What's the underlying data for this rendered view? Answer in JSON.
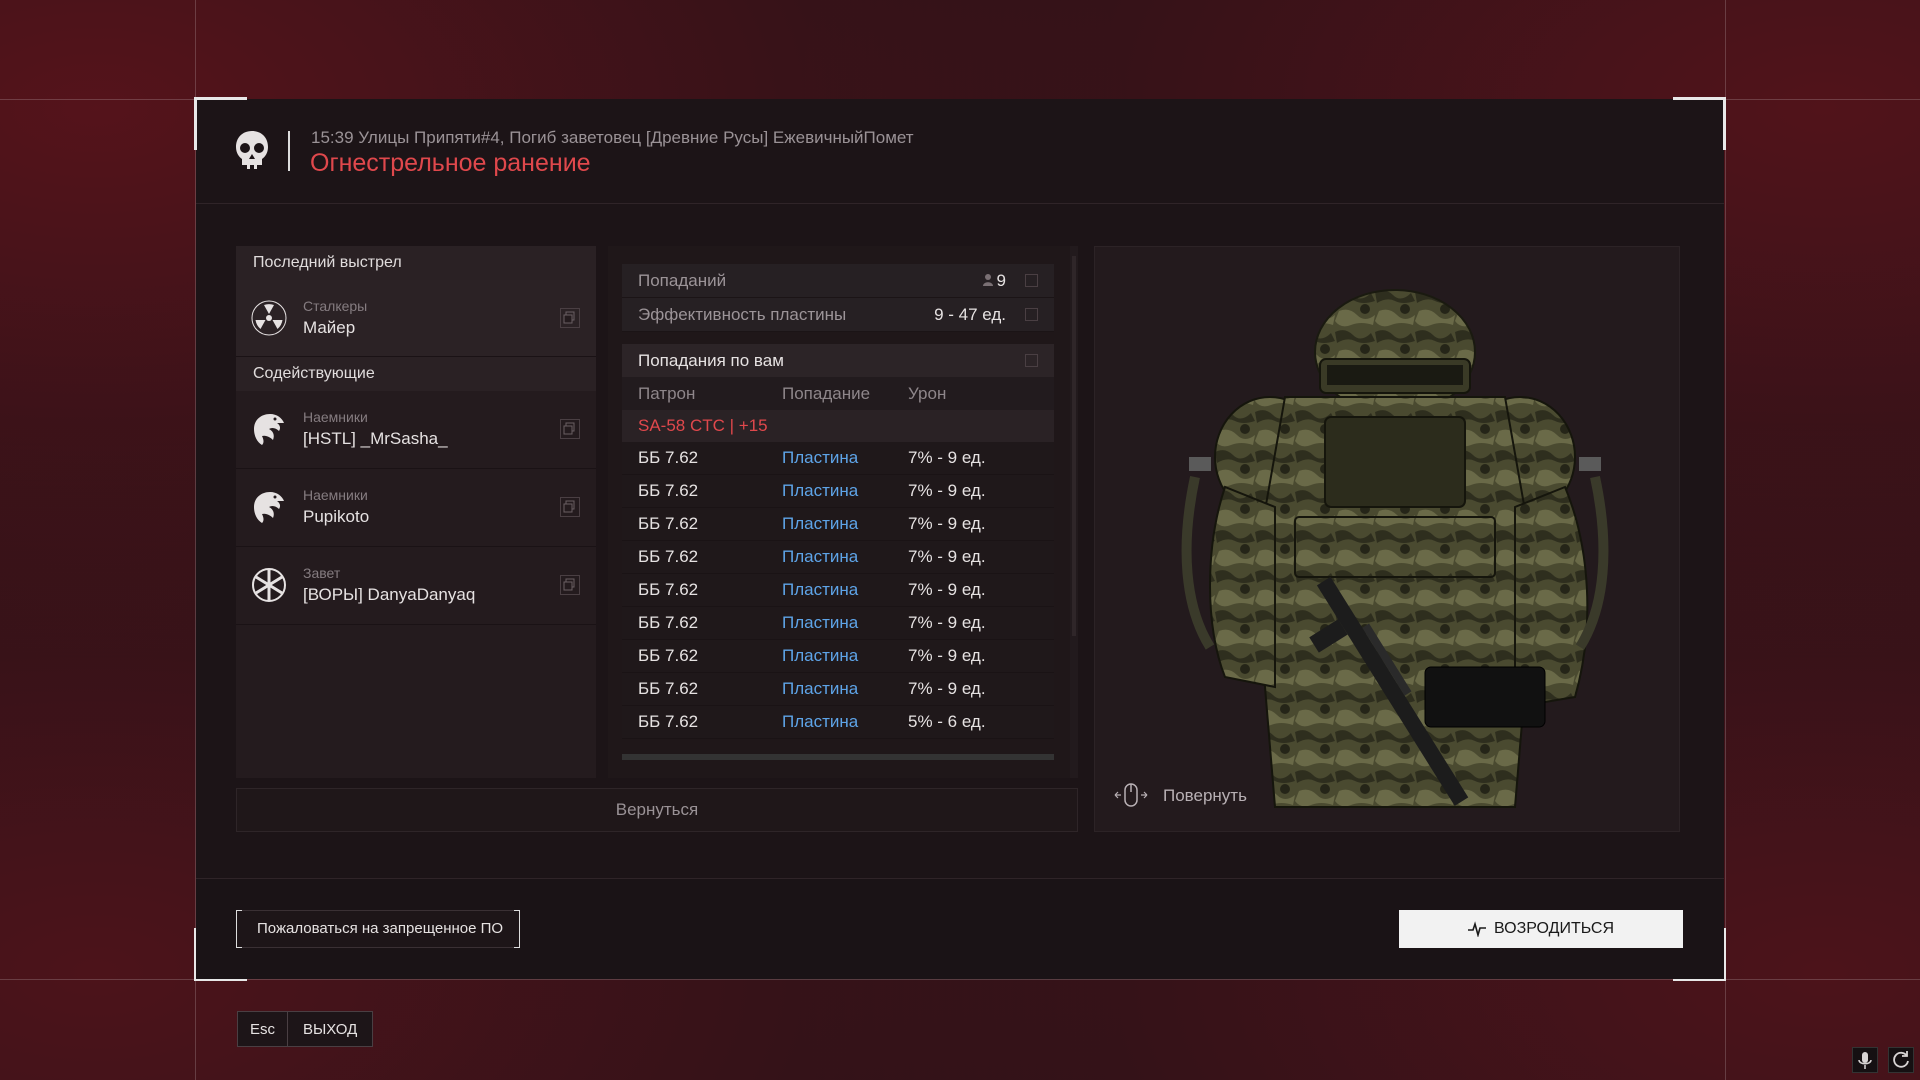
{
  "header": {
    "info": "15:39 Улицы Припяти#4, Погиб заветовец [Древние Русы] ЕжевичныйПомет",
    "cause": "Огнестрельное ранение"
  },
  "killer_section": {
    "title": "Последний выстрел",
    "faction": "Сталкеры",
    "name": "Майер"
  },
  "assist_section": {
    "title": "Содействующие",
    "items": [
      {
        "faction": "Наемники",
        "name": "[HSTL] _MrSasha_"
      },
      {
        "faction": "Наемники",
        "name": "Pupikoto"
      },
      {
        "faction": "Завет",
        "name": "[ВОРЫ] DanyaDanyaq"
      }
    ]
  },
  "stats": {
    "hits_label": "Попаданий",
    "hits_value": "9",
    "plate_label": "Эффективность пластины",
    "plate_value": "9 - 47 ед."
  },
  "hits_table": {
    "title": "Попадания по вам",
    "columns": [
      "Патрон",
      "Попадание",
      "Урон"
    ],
    "weapon": "SA-58 CTC | +15",
    "rows": [
      {
        "ammo": "ББ 7.62",
        "hit": "Пластина",
        "damage": "7% - 9 ед."
      },
      {
        "ammo": "ББ 7.62",
        "hit": "Пластина",
        "damage": "7% - 9 ед."
      },
      {
        "ammo": "ББ 7.62",
        "hit": "Пластина",
        "damage": "7% - 9 ед."
      },
      {
        "ammo": "ББ 7.62",
        "hit": "Пластина",
        "damage": "7% - 9 ед."
      },
      {
        "ammo": "ББ 7.62",
        "hit": "Пластина",
        "damage": "7% - 9 ед."
      },
      {
        "ammo": "ББ 7.62",
        "hit": "Пластина",
        "damage": "7% - 9 ед."
      },
      {
        "ammo": "ББ 7.62",
        "hit": "Пластина",
        "damage": "7% - 9 ед."
      },
      {
        "ammo": "ББ 7.62",
        "hit": "Пластина",
        "damage": "7% - 9 ед."
      },
      {
        "ammo": "ББ 7.62",
        "hit": "Пластина",
        "damage": "5% - 6 ед."
      }
    ]
  },
  "back_label": "Вернуться",
  "rotate_label": "Повернуть",
  "report_label": "Пожаловаться на запрещенное ПО",
  "respawn_label": "ВОЗРОДИТЬСЯ",
  "esc_label": "Esc",
  "exit_label": "ВЫХОД",
  "colors": {
    "accent_red": "#e0484c",
    "hit_blue": "#5ea4e8"
  }
}
